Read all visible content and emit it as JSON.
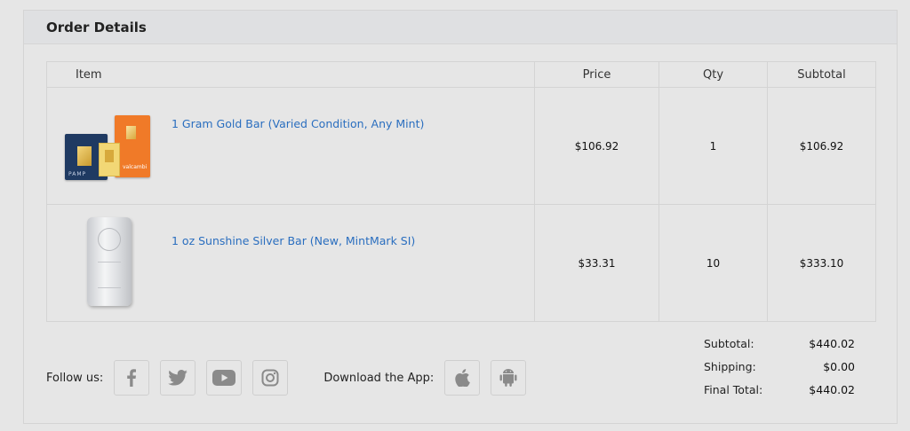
{
  "order": {
    "title": "Order Details",
    "columns": {
      "item": "Item",
      "price": "Price",
      "qty": "Qty",
      "subtotal": "Subtotal"
    },
    "items": [
      {
        "name": "1 Gram Gold Bar (Varied Condition, Any Mint)",
        "price": "$106.92",
        "qty": "1",
        "subtotal": "$106.92",
        "image": "gold-bar-product-image"
      },
      {
        "name": "1 oz Sunshine Silver Bar (New, MintMark SI)",
        "price": "$33.31",
        "qty": "10",
        "subtotal": "$333.10",
        "image": "silver-bar-product-image"
      }
    ]
  },
  "footer": {
    "follow_label": "Follow us:",
    "social_icons": [
      "facebook-icon",
      "twitter-icon",
      "youtube-icon",
      "instagram-icon"
    ],
    "app_label": "Download the App:",
    "app_icons": [
      "apple-icon",
      "android-icon"
    ],
    "icon_color": "#8a8a8a"
  },
  "totals": {
    "subtotal_label": "Subtotal:",
    "subtotal_value": "$440.02",
    "shipping_label": "Shipping:",
    "shipping_value": "$0.00",
    "final_label": "Final Total:",
    "final_value": "$440.02"
  },
  "colors": {
    "link": "#2a6ebf",
    "background": "#e6e6e6",
    "header_bg": "#dfe0e2"
  }
}
